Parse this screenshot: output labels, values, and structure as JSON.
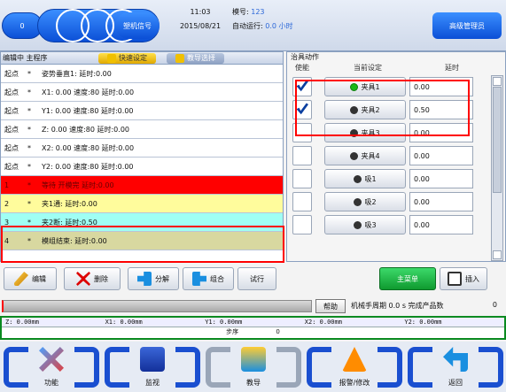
{
  "topbar": {
    "left_value": "0",
    "plastic_signal": "塑机信号",
    "time": "11:03",
    "date": "2015/08/21",
    "model_label": "模号:",
    "model_value": "123",
    "auto_label": "自动运行:",
    "auto_value": "0.0 小时",
    "admin": "高级管理员"
  },
  "program": {
    "title": "编辑中 主程序",
    "quick_set": "快速设定",
    "teach_select": "教导选择",
    "rows": [
      {
        "step": "起点",
        "dot": "*",
        "text": "姿势垂直1: 延时:0.00",
        "style": "plain"
      },
      {
        "step": "起点",
        "dot": "*",
        "text": "X1: 0.00 速度:80 延时:0.00",
        "style": "plain"
      },
      {
        "step": "起点",
        "dot": "*",
        "text": "Y1: 0.00 速度:80 延时:0.00",
        "style": "plain"
      },
      {
        "step": "起点",
        "dot": "*",
        "text": "Z: 0.00 速度:80 延时:0.00",
        "style": "plain"
      },
      {
        "step": "起点",
        "dot": "*",
        "text": "X2: 0.00 速度:80 延时:0.00",
        "style": "plain"
      },
      {
        "step": "起点",
        "dot": "*",
        "text": "Y2: 0.00 速度:80 延时:0.00",
        "style": "plain"
      },
      {
        "step": "1",
        "dot": "*",
        "text": "等待 开模完 延时:0.00",
        "style": "red"
      },
      {
        "step": "2",
        "dot": "*",
        "text": "夹1通: 延时:0.00",
        "style": "yellow"
      },
      {
        "step": "3",
        "dot": "*",
        "text": "夹2断: 延时:0.50",
        "style": "cyan"
      },
      {
        "step": "4",
        "dot": "*",
        "text": "模组结束: 延时:0.00",
        "style": "khaki"
      }
    ]
  },
  "fixture": {
    "title": "治具动作",
    "col_enable": "使能",
    "col_setting": "当前设定",
    "col_delay": "延时",
    "rows": [
      {
        "enabled": true,
        "on": true,
        "label": "夹具1",
        "delay": "0.00"
      },
      {
        "enabled": true,
        "on": false,
        "label": "夹具2",
        "delay": "0.50"
      },
      {
        "enabled": false,
        "on": false,
        "label": "夹具3",
        "delay": "0.00"
      },
      {
        "enabled": false,
        "on": false,
        "label": "夹具4",
        "delay": "0.00"
      },
      {
        "enabled": false,
        "on": false,
        "label": "吸1",
        "delay": "0.00"
      },
      {
        "enabled": false,
        "on": false,
        "label": "吸2",
        "delay": "0.00"
      },
      {
        "enabled": false,
        "on": false,
        "label": "吸3",
        "delay": "0.00"
      }
    ]
  },
  "toolbar": {
    "edit": "编辑",
    "delete": "删除",
    "split": "分解",
    "merge": "组合",
    "test": "试行",
    "main_menu": "主菜单",
    "insert": "插入"
  },
  "status": {
    "help": "帮助",
    "cycle_label": "机械手周期",
    "cycle_value": "0.0 s",
    "finished_label": "完成产品数",
    "finished_value": "0"
  },
  "coords": {
    "z": "Z:      0.00mm",
    "x1": "X1:     0.00mm",
    "y1": "Y1:     0.00mm",
    "x2": "X2:     0.00mm",
    "y2": "Y2:     0.00mm",
    "step_label": "步序",
    "step_value": "0"
  },
  "nav": [
    {
      "label": "功能",
      "icon": "wrench-screwdriver-icon"
    },
    {
      "label": "监视",
      "icon": "monitor-icon"
    },
    {
      "label": "教导",
      "icon": "teach-icon"
    },
    {
      "label": "报警/修改",
      "icon": "alarm-icon"
    },
    {
      "label": "返回",
      "icon": "back-arrow-icon"
    }
  ]
}
